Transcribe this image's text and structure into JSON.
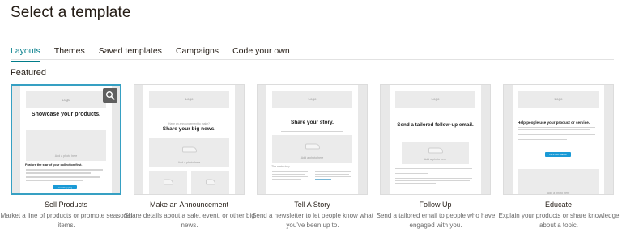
{
  "page": {
    "title": "Select a template"
  },
  "tabs": [
    {
      "label": "Layouts",
      "active": true
    },
    {
      "label": "Themes",
      "active": false
    },
    {
      "label": "Saved templates",
      "active": false
    },
    {
      "label": "Campaigns",
      "active": false
    },
    {
      "label": "Code your own",
      "active": false
    }
  ],
  "section": {
    "title": "Featured"
  },
  "colors": {
    "accent": "#007c89",
    "selected_border": "#36a0c3",
    "button_blue": "#1a9ad6"
  },
  "templates": [
    {
      "name": "Sell Products",
      "description": "Market a line of products or promote seasonal items.",
      "preview": {
        "logo": "Logo",
        "heading": "Showcase your products.",
        "photo": "Add a photo here",
        "subheading": "Feature the star of your collection first.",
        "button": "Start Shopping"
      },
      "selected": true,
      "zoom_icon": "magnifier-icon"
    },
    {
      "name": "Make an Announcement",
      "description": "Share details about a sale, event, or other big news.",
      "preview": {
        "logo": "Logo",
        "kicker": "Have an announcement to make?",
        "heading": "Share your big news.",
        "photo": "Add a photo here"
      }
    },
    {
      "name": "Tell A Story",
      "description": "Send a newsletter to let people know what you've been up to.",
      "preview": {
        "logo": "Logo",
        "heading": "Share your story.",
        "photo": "Add a photo here",
        "subheading": "The main story"
      }
    },
    {
      "name": "Follow Up",
      "description": "Send a tailored email to people who have engaged with you.",
      "preview": {
        "logo": "Logo",
        "heading": "Send a tailored follow-up email.",
        "photo": "Add a photo here"
      }
    },
    {
      "name": "Educate",
      "description": "Explain your products or share knowledge about a topic.",
      "preview": {
        "logo": "Logo",
        "heading": "Help people use your product or service.",
        "button": "Let's Get Started",
        "photo": "Add a photo here"
      }
    }
  ]
}
